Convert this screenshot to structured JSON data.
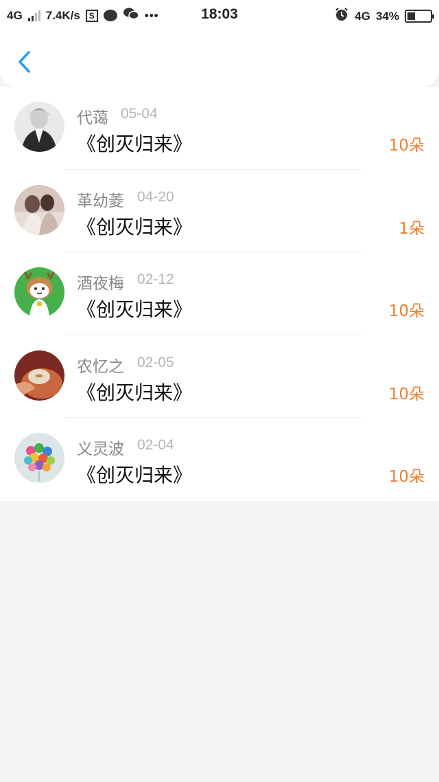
{
  "status_bar": {
    "network": "4G",
    "speed": "7.4K/s",
    "s_icon": "S",
    "time": "18:03",
    "network2": "4G",
    "battery": "34%",
    "battery_level": 0.34
  },
  "header": {
    "back_icon": "chevron-left-icon",
    "accent_color": "#2d9cf3"
  },
  "gifts": [
    {
      "name": "代蔼",
      "date": "05-04",
      "title": "《创灭归来》",
      "amount": "10朵"
    },
    {
      "name": "革幼菱",
      "date": "04-20",
      "title": "《创灭归来》",
      "amount": "1朵"
    },
    {
      "name": "酒夜梅",
      "date": "02-12",
      "title": "《创灭归来》",
      "amount": "10朵"
    },
    {
      "name": "农忆之",
      "date": "02-05",
      "title": "《创灭归来》",
      "amount": "10朵"
    },
    {
      "name": "义灵波",
      "date": "02-04",
      "title": "《创灭归来》",
      "amount": "10朵"
    }
  ],
  "colors": {
    "amount": "#f07d2d",
    "background": "#f6f5f6"
  }
}
